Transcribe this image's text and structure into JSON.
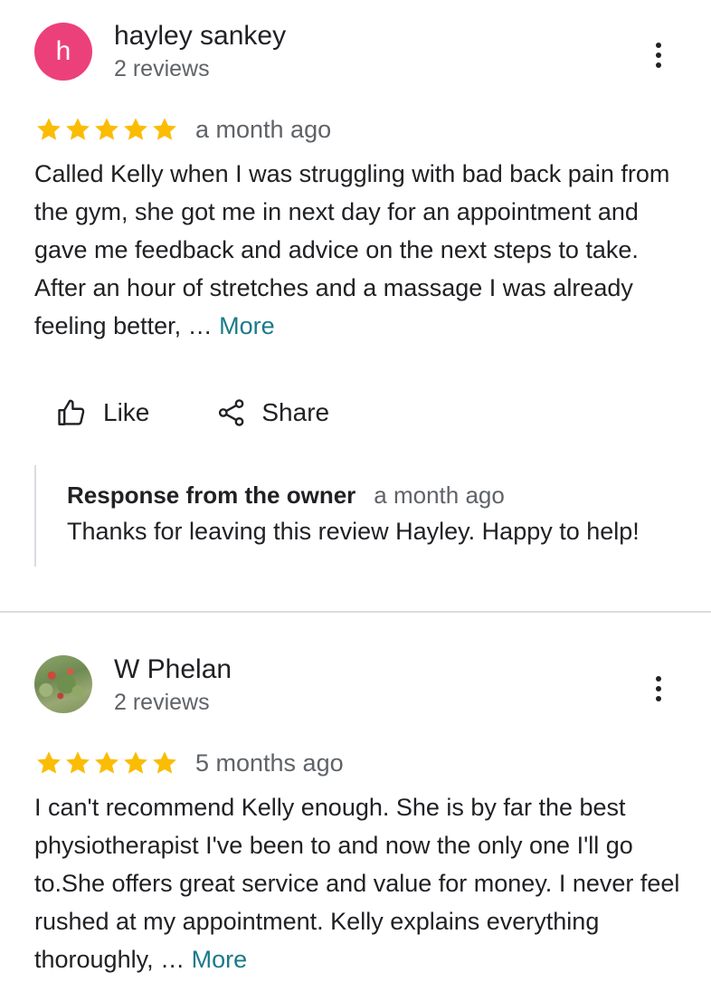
{
  "reviews": [
    {
      "author": "hayley sankey",
      "avatar_letter": "h",
      "review_count": "2 reviews",
      "rating": 5,
      "date": "a month ago",
      "text": "Called Kelly when I was struggling with bad back pain from the gym, she got me in next day for an appointment and gave me feedback and advice on the next steps to take. After an hour of stretches and a massage I was already feeling better, …",
      "more_label": "More",
      "like_label": "Like",
      "share_label": "Share",
      "owner_response": {
        "title": "Response from the owner",
        "date": "a month ago",
        "text": "Thanks for leaving this review Hayley. Happy to help!"
      }
    },
    {
      "author": "W Phelan",
      "review_count": "2 reviews",
      "rating": 5,
      "date": "5 months ago",
      "text": "I can't recommend Kelly enough. She is by far the best physiotherapist I've been to and now the only one I'll go to.She offers great service and value for money. I never feel rushed at my appointment. Kelly explains everything thoroughly, …",
      "more_label": "More"
    }
  ],
  "colors": {
    "star": "#fbbc04",
    "avatar_h": "#ec407a",
    "link": "#1a7a8a",
    "secondary_text": "#5f6368",
    "divider": "#dadce0"
  },
  "icons": {
    "menu": "more-vert-icon",
    "like": "thumb-up-icon",
    "share": "share-icon",
    "star": "star-icon"
  }
}
